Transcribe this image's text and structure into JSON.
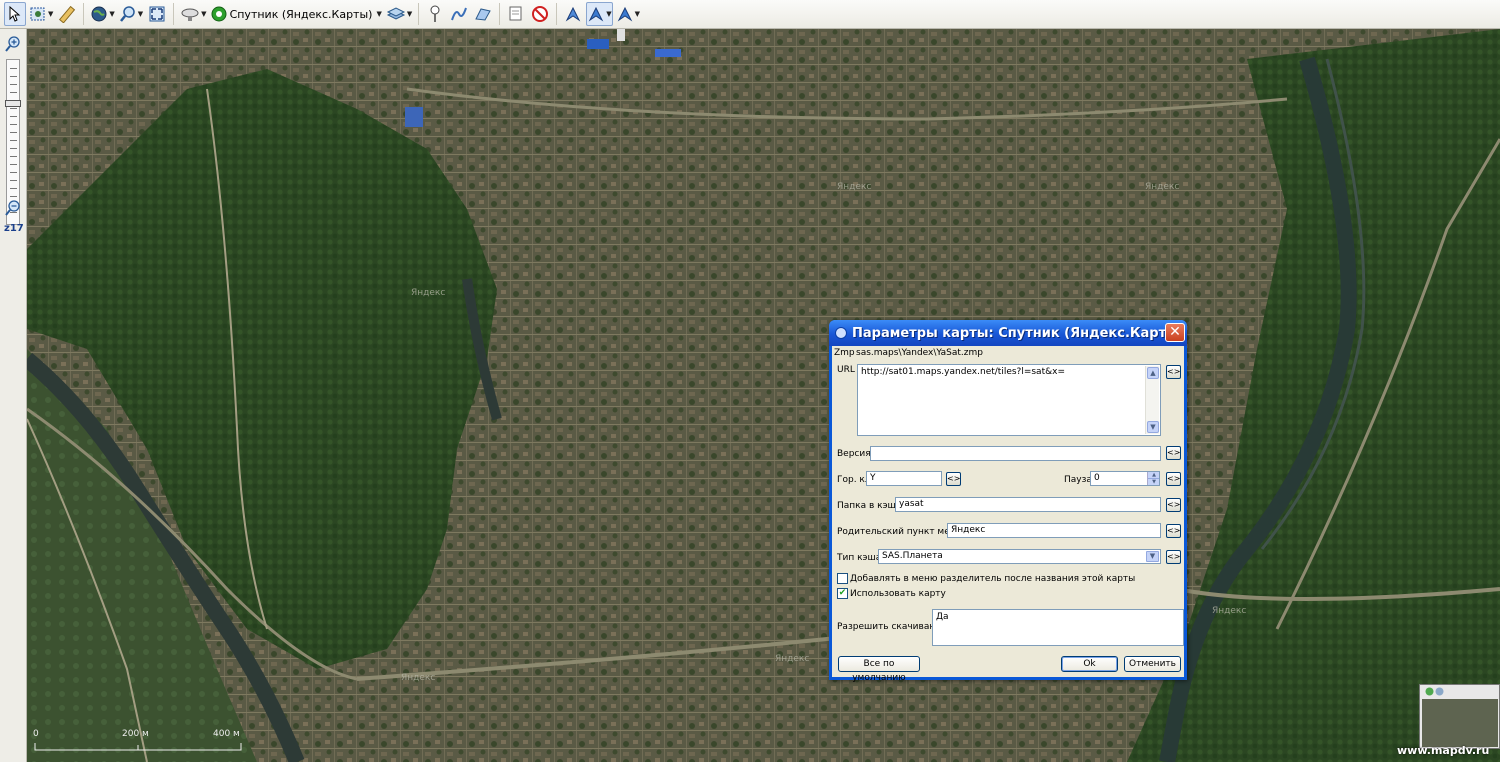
{
  "toolbar": {
    "current_map_label": "Спутник (Яндекс.Карты)"
  },
  "zoombar": {
    "zoom_level": "z17"
  },
  "map": {
    "watermark_labels": [
      "Яндекс",
      "Яндекс",
      "Яндекс",
      "Яндекс",
      "Яндекс",
      "Яндекс"
    ],
    "scale": {
      "zero": "0",
      "mid": "200 м",
      "end": "400 м"
    },
    "site_watermark": "www.mapdv.ru"
  },
  "dialog": {
    "title": "Параметры карты: Спутник (Яндекс.Карты)",
    "close": "✕",
    "zmp_label": "Zmp",
    "zmp_value": "sas.maps\\Yandex\\YaSat.zmp",
    "url_label": "URL",
    "url_value": "http://sat01.maps.yandex.net/tiles?l=sat&x=",
    "version_label": "Версия",
    "version_value": "",
    "hotkey_label": "Гор. кл",
    "hotkey_value": "Y",
    "pause_label": "Пауза",
    "pause_value": "0",
    "cache_folder_label": "Папка в кэше",
    "cache_folder_value": "yasat",
    "parent_menu_label": "Родительский пункт меню",
    "parent_menu_value": "Яндекс",
    "cache_type_label": "Тип кэша",
    "cache_type_value": "SAS.Планета",
    "separator_checkbox_label": "Добавлять в меню разделитель после названия этой карты",
    "separator_checked": false,
    "use_map_checkbox_label": "Использовать карту",
    "use_map_checked": true,
    "allow_download_label": "Разрешить скачивание",
    "allow_download_value": "Да",
    "reset_button": "Все по умолчанию",
    "ok_button": "Ok",
    "cancel_button": "Отменить",
    "small_button_label": "<>"
  }
}
